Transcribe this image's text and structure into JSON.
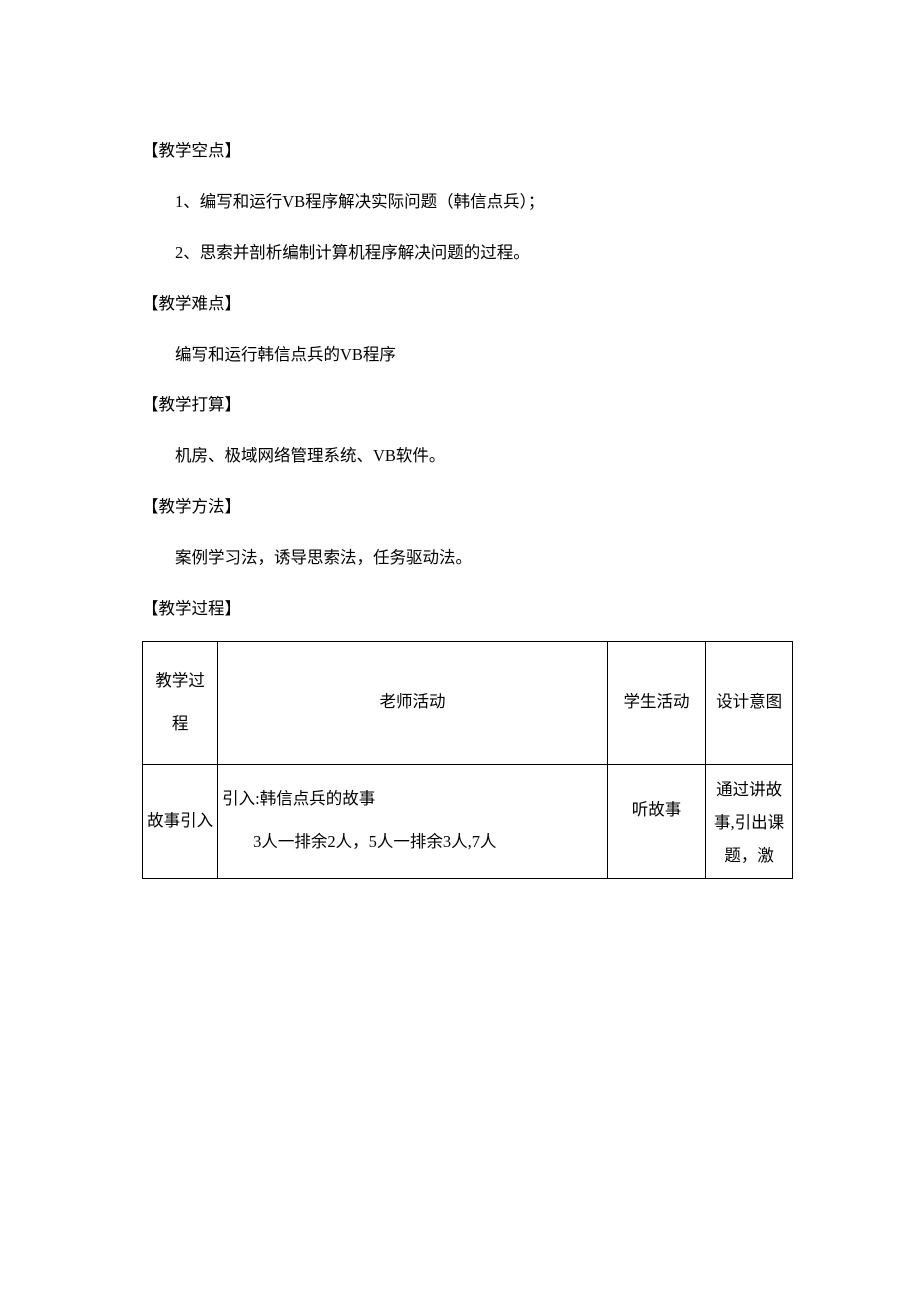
{
  "sections": {
    "s1_title": "【教学空点】",
    "s1_item1": "1、编写和运行VB程序解决实际问题（韩信点兵）；",
    "s1_item2": "2、思索并剖析编制计算机程序解决问题的过程。",
    "s2_title": "【教学难点】",
    "s2_body": "编写和运行韩信点兵的VB程序",
    "s3_title": "【教学打算】",
    "s3_body": "机房、极域网络管理系统、VB软件。",
    "s4_title": "【教学方法】",
    "s4_body": "案例学习法，诱导思索法，任务驱动法。",
    "s5_title": "【教学过程】"
  },
  "table": {
    "header": {
      "c1": "教学过程",
      "c2": "老师活动",
      "c3": "学生活动",
      "c4": "设计意图"
    },
    "row1": {
      "c1": "故事引入",
      "c2_line1": "引入:韩信点兵的故事",
      "c2_line2": "3人一排余2人，5人一排余3人,7人",
      "c3": "听故事",
      "c4": "通过讲故事,引出课题，激"
    }
  }
}
